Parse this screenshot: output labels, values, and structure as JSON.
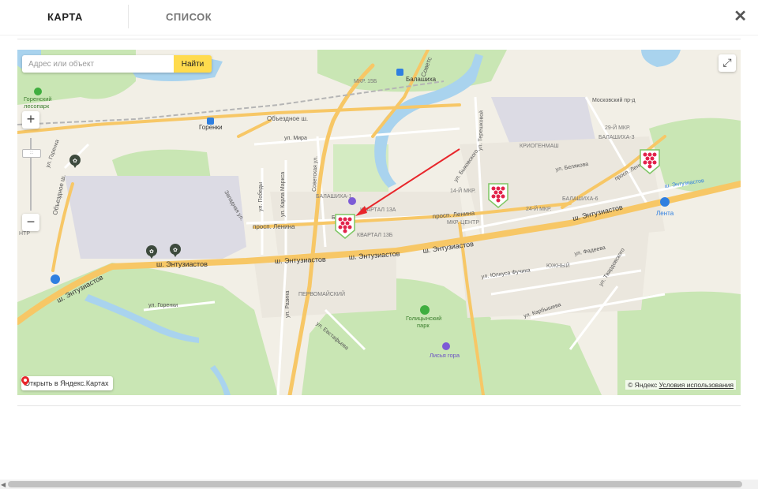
{
  "tabs": {
    "map": "КАРТА",
    "list": "СПИСОК"
  },
  "close_symbol": "✕",
  "search": {
    "placeholder": "Адрес или объект",
    "button": "Найти"
  },
  "controls": {
    "zoom_in": "+",
    "zoom_out": "−",
    "fullscreen": "⤢"
  },
  "open_in_yandex": "Открыть в Яндекс.Картах",
  "copyright": {
    "brand": "© Яндекс",
    "terms": "Условия использования"
  },
  "map_labels": {
    "gorenski_park": "Горенский\nлесопарк",
    "gorenki": "Горенки",
    "balashikha": "Балашиха",
    "mkr15b": "МКР. 15Б",
    "obezdnoe_top": "Объездное ш.",
    "obezdnoe_left": "Объездное ш.",
    "ul_gorenka": "ул. Горенка",
    "ul_mira": "ул. Мира",
    "ul_pobedy": "ул. Победы",
    "ul_karla_marksa": "ул. Карла Маркса",
    "sovetskaya": "Советская ул.",
    "zapadnaya": "Западная ул.",
    "balashikha1": "БАЛАШИХА-1",
    "kvartal13a": "КВАРТАЛ 13А",
    "kvartal13b": "КВАРТАЛ 13Б",
    "prosp_lenina_w": "просп. Ленина",
    "prosp_lenina_e": "просп. Ленина",
    "mkr_center": "МКР. ЦЕНТР",
    "mkr14": "14-Й МКР.",
    "mkr24": "24-Й МКР.",
    "kriogenmash": "КРИОГЕНМАШ",
    "balashikha6": "БАЛАШИХА-6",
    "balashikha3": "БАЛАШИХА-3",
    "mkr29": "29-Й МКР.",
    "moskovsky": "Московский пр-д",
    "ul_belyakova": "ул. Белякова",
    "ul_bykovskogo": "ул. Быковского",
    "ul_tereshkovoy": "ул. Терешковой",
    "prosp_lenina_ne": "просп. Ленина",
    "entuziastov_1": "ш. Энтузиастов",
    "entuziastov_2": "ш. Энтузиастов",
    "entuziastov_3": "ш. Энтузиастов",
    "entuziastov_4": "ш. Энтузиастов",
    "entuziastov_5": "ш. Энтузиастов",
    "entuziastov_6": "ш. Энтузиастов",
    "lenta": "Лента",
    "ul_fadeeva": "ул. Фадеева",
    "ul_fuchika": "ул. Юлиуса Фучика",
    "yuzhny": "ЮЖНЫЙ",
    "ul_tvardovskogo": "ул. Твардовского",
    "ul_karbysheva": "ул. Карбышева",
    "pervomaysky": "ПЕРВОМАЙСКИЙ",
    "ul_razina": "ул. Разина",
    "ul_evstafeva": "ул. Евстафьева",
    "golitsyn_park": "Голицынский\nпарк",
    "lisya_gora": "Лисья гора",
    "ul_gorenki": "ул. Горенки",
    "ba": "Ба",
    "sovets": "Советс",
    "ntr": "НТР"
  },
  "colors": {
    "road_major": "#f7c766",
    "road_minor": "#ffffff",
    "water": "#a9d3ee",
    "park": "#c9e6b4",
    "urban": "#ebe7de",
    "industrial": "#dcdbe4",
    "arrow": "#e8262b",
    "marker_red": "#e2234b",
    "marker_bg": "#ffffff",
    "marker_border": "#7ec664"
  }
}
